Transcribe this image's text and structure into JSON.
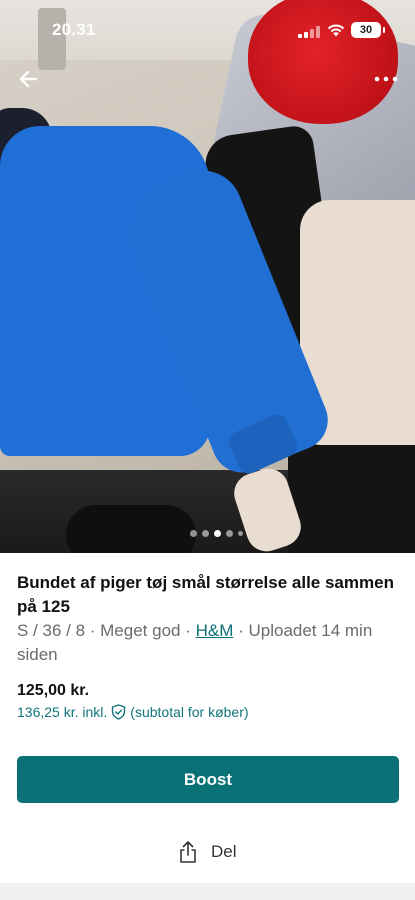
{
  "status_bar": {
    "time": "20.31",
    "battery": "30"
  },
  "photo": {
    "description_icon": "photo-carousel",
    "page_count": 5,
    "active_page": 3
  },
  "listing": {
    "title": "Bundet af piger tøj smål størrelse  alle sammen på 125",
    "meta_prefix": "S / 36 / 8 · Meget god · ",
    "brand": "H&M",
    "meta_suffix": " · Uploadet 14 min siden",
    "price": "125,00 kr.",
    "price_incl": "136,25 kr. inkl.",
    "price_incl_note": "(subtotal for køber)"
  },
  "actions": {
    "boost_label": "Boost",
    "share_label": "Del"
  },
  "colors": {
    "accent": "#0a7277",
    "link": "#0e6f75"
  }
}
